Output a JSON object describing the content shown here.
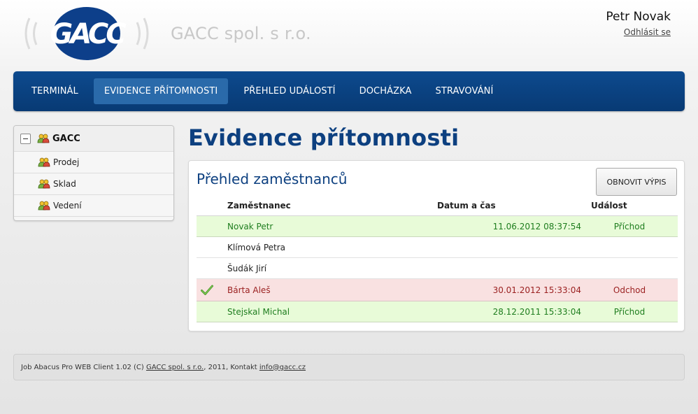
{
  "header": {
    "logo_text": "GACC",
    "company_name": "GACC spol. s r.o.",
    "user_name": "Petr Novak",
    "logout_label": "Odhlásit se"
  },
  "nav": {
    "items": [
      {
        "label": "TERMINÁL"
      },
      {
        "label": "EVIDENCE PŘÍTOMNOSTI",
        "active": true
      },
      {
        "label": "PŘEHLED UDÁLOSTÍ"
      },
      {
        "label": "DOCHÁZKA"
      },
      {
        "label": "STRAVOVÁNÍ"
      }
    ]
  },
  "sidebar": {
    "root_label": "GACC",
    "items": [
      {
        "label": "Prodej"
      },
      {
        "label": "Sklad"
      },
      {
        "label": "Vedení"
      }
    ]
  },
  "main": {
    "page_title": "Evidence přítomnosti",
    "panel_title": "Přehled zaměstnanců",
    "refresh_label": "OBNOVIT VÝPIS",
    "columns": [
      "Zaměstnanec",
      "Datum a čas",
      "Událost"
    ],
    "rows": [
      {
        "name": "Novak Petr",
        "datetime": "11.06.2012 08:37:54",
        "event": "Příchod",
        "status": "green",
        "icon": ""
      },
      {
        "name": "Klímová Petra",
        "datetime": "",
        "event": "",
        "status": "none",
        "icon": ""
      },
      {
        "name": "Šudák Jirí",
        "datetime": "",
        "event": "",
        "status": "none",
        "icon": ""
      },
      {
        "name": "Bárta Aleš",
        "datetime": "30.01.2012 15:33:04",
        "event": "Odchod",
        "status": "red",
        "icon": "checkmark-icon"
      },
      {
        "name": "Stejskal Michal",
        "datetime": "28.12.2011 15:33:04",
        "event": "Příchod",
        "status": "green",
        "icon": ""
      }
    ]
  },
  "footer": {
    "text_before": "Job Abacus Pro WEB Client 1.02 (C) ",
    "company_link": "GACC spol. s r.o.",
    "text_middle": ", 2011, Kontakt ",
    "email_link": "info@gacc.cz"
  },
  "colors": {
    "nav_bg": "#0b4382",
    "title_blue": "#0d4080",
    "row_green": "#e8fbd8",
    "row_red": "#f9e1e1"
  }
}
